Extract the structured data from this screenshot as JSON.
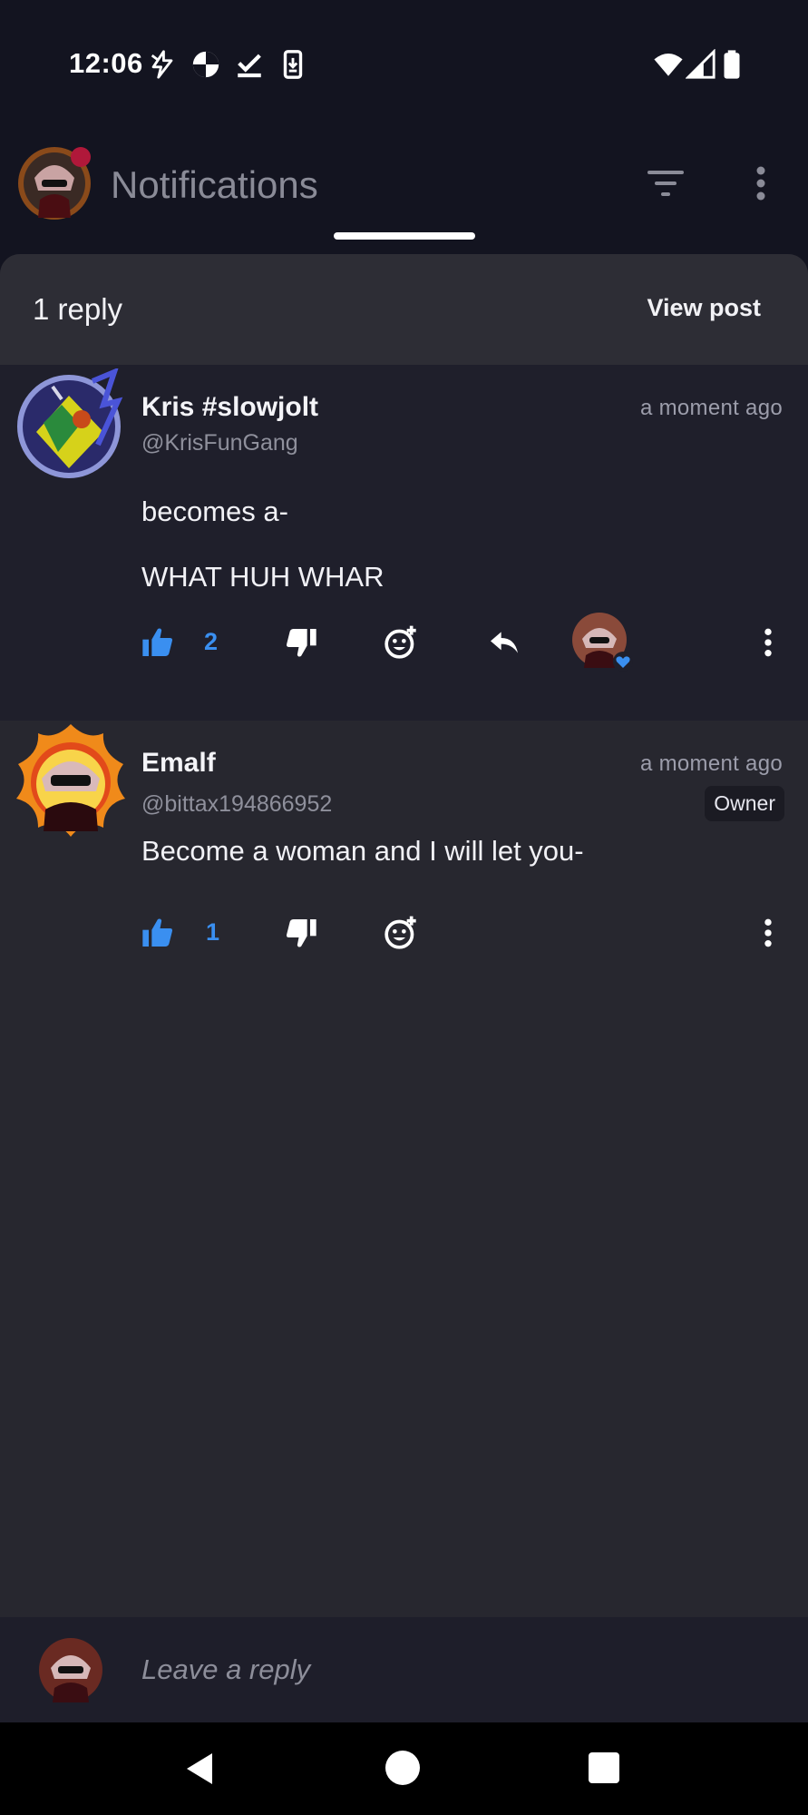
{
  "status_bar": {
    "time": "12:06",
    "icons": [
      "flash-icon",
      "media-icon",
      "download-done-icon",
      "phone-download-icon",
      "wifi-icon",
      "signal-icon",
      "battery-icon"
    ]
  },
  "header": {
    "title": "Notifications",
    "icons": [
      "avatar",
      "filter-icon",
      "more-vert-icon"
    ]
  },
  "sheet": {
    "reply_count": "1 reply",
    "view_post": "View post"
  },
  "comments": [
    {
      "name": "Kris #slowjolt",
      "handle": "@KrisFunGang",
      "time": "a moment ago",
      "lines": [
        "becomes a-",
        "WHAT HUH WHAR"
      ],
      "likes": "2",
      "actions": [
        "like-icon",
        "dislike-icon",
        "add-reaction-icon",
        "reply-icon",
        "owner-heart-avatar",
        "more-vert-icon"
      ]
    },
    {
      "name": "Emalf",
      "handle": "@bittax194866952",
      "time": "a moment ago",
      "badge": "Owner",
      "lines": [
        "Become a woman and I will let you-"
      ],
      "likes": "1",
      "actions": [
        "like-icon",
        "dislike-icon",
        "add-reaction-icon",
        "more-vert-icon"
      ]
    }
  ],
  "reply_bar": {
    "placeholder": "Leave a reply"
  },
  "colors": {
    "background": "#131420",
    "sheet": "#27272f",
    "parent_comment": "#1f1f2b",
    "accent": "#3a8ff0",
    "muted_text": "#8f909c"
  },
  "nav_bar": {
    "icons": [
      "back-icon",
      "home-icon",
      "recents-icon"
    ]
  }
}
